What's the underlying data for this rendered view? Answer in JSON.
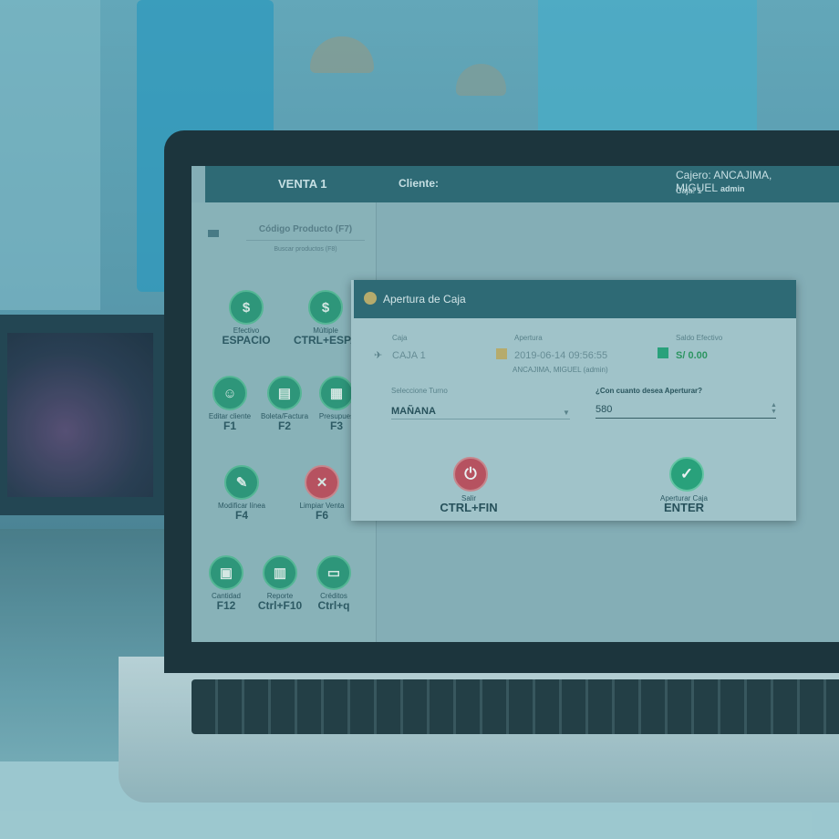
{
  "header": {
    "venta": "VENTA 1",
    "cliente_label": "Cliente:",
    "cajero": "Cajero: ANCAJIMA, MIGUEL",
    "role": "admin",
    "caja": "Caja: 1"
  },
  "product_search": {
    "label": "Código Producto (F7)",
    "sub": "Buscar productos (F8)"
  },
  "functions": [
    {
      "label": "Efectivo",
      "key": "ESPACIO",
      "icon": "cash-icon"
    },
    {
      "label": "Múltiple",
      "key": "CTRL+ESPAC",
      "icon": "multi-payment-icon"
    },
    {
      "label": "Editar cliente",
      "key": "F1",
      "icon": "edit-client-icon"
    },
    {
      "label": "Boleta/Factura",
      "key": "F2",
      "icon": "invoice-icon"
    },
    {
      "label": "Presupues",
      "key": "F3",
      "icon": "budget-icon"
    },
    {
      "label": "Modificar línea",
      "key": "F4",
      "icon": "edit-line-icon"
    },
    {
      "label": "Limpiar Venta",
      "key": "F6",
      "icon": "clear-icon"
    },
    {
      "label": "Cantidad",
      "key": "F12",
      "icon": "quantity-icon"
    },
    {
      "label": "Reporte",
      "key": "Ctrl+F10",
      "icon": "report-icon"
    },
    {
      "label": "Créditos",
      "key": "Ctrl+q",
      "icon": "credits-icon"
    }
  ],
  "modal": {
    "title": "Apertura de Caja",
    "caja_label": "Caja",
    "caja_value": "CAJA 1",
    "apertura_label": "Apertura",
    "apertura_value": "2019-06-14 09:56:55",
    "apertura_user": "ANCAJIMA, MIGUEL (admin)",
    "saldo_label": "Saldo Efectivo",
    "saldo_value": "S/ 0.00",
    "turno_label": "Seleccione Turno",
    "turno_value": "MAÑANA",
    "amount_label": "¿Con cuanto desea Aperturar?",
    "amount_value": "580",
    "exit_label": "Salir",
    "exit_key": "CTRL+FIN",
    "open_label": "Aperturar Caja",
    "open_key": "ENTER"
  },
  "colors": {
    "header": "#2f6a74",
    "accent_green": "#2aa77b",
    "exit_red": "#c7505d"
  }
}
